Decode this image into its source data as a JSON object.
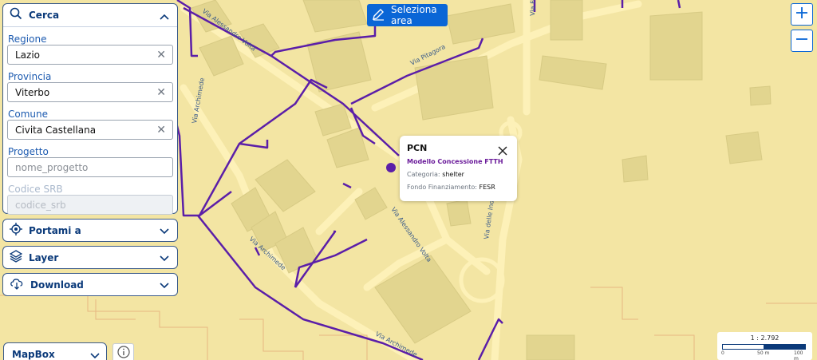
{
  "search": {
    "title": "Cerca",
    "fields": [
      {
        "label": "Regione",
        "value": "Lazio",
        "placeholder": ""
      },
      {
        "label": "Provincia",
        "value": "Viterbo",
        "placeholder": ""
      },
      {
        "label": "Comune",
        "value": "Civita Castellana",
        "placeholder": ""
      },
      {
        "label": "Progetto",
        "value": "",
        "placeholder": "nome_progetto"
      },
      {
        "label": "Codice SRB",
        "value": "",
        "placeholder": "codice_srb"
      }
    ]
  },
  "accordions": {
    "portami": "Portami a",
    "layer": "Layer",
    "download": "Download"
  },
  "toolbar": {
    "select_area": "Seleziona area"
  },
  "popup": {
    "title": "PCN",
    "subtitle": "Modello Concessione FTTH",
    "category_key": "Categoria:",
    "category_val": "shelter",
    "fund_key": "Fondo Finanziamento:",
    "fund_val": "FESR"
  },
  "basemap": {
    "selected": "MapBox"
  },
  "scale": {
    "ratio": "1 : 2.792",
    "ticks": [
      "0",
      "50 m",
      "100 m"
    ]
  },
  "streets": [
    "Via Alessandro Volta",
    "Via Pitagora",
    "Via Archimede",
    "Via Alessandro Volta",
    "Via Archimede",
    "Via Archimede",
    "Via delle Ind",
    "Via Fr"
  ],
  "colors": {
    "map_bg": "#f3e5a3",
    "building": "#e2d58f",
    "road": "#fdf1b8",
    "network_line": "#5b1ea8",
    "accent": "#0a66d6",
    "panel_title": "#0b3a7a"
  }
}
